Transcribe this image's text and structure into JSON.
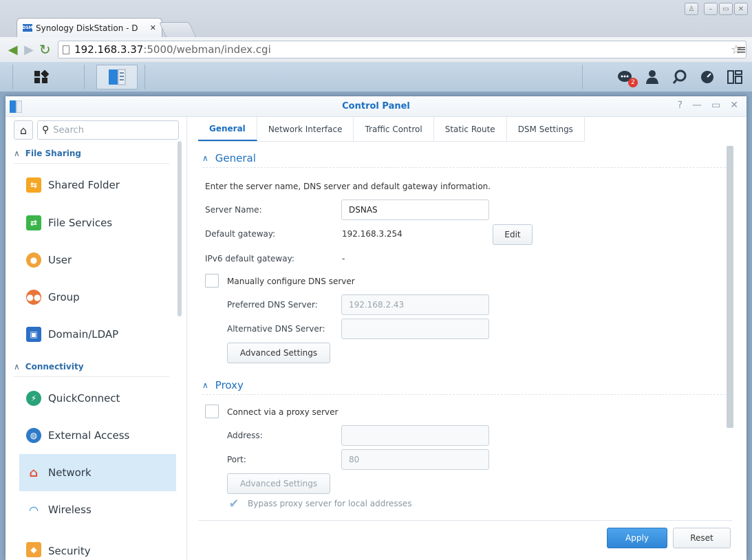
{
  "browser": {
    "tab_title": "Synology DiskStation - D",
    "favicon_text": "DSM",
    "url_host": "192.168.3.37",
    "url_rest": ":5000/webman/index.cgi"
  },
  "taskbar": {
    "notification_count": "2"
  },
  "window": {
    "title": "Control Panel"
  },
  "sidebar": {
    "search_placeholder": "Search",
    "sections": [
      {
        "label": "File Sharing"
      },
      {
        "label": "Connectivity"
      }
    ],
    "items": [
      {
        "label": "Shared Folder",
        "icon": "shared-folder-icon",
        "color": "#f5a623"
      },
      {
        "label": "File Services",
        "icon": "file-services-icon",
        "color": "#3bb54a"
      },
      {
        "label": "User",
        "icon": "user-icon",
        "color": "#f0a33a"
      },
      {
        "label": "Group",
        "icon": "group-icon",
        "color": "#e9753b"
      },
      {
        "label": "Domain/LDAP",
        "icon": "domain-ldap-icon",
        "color": "#2b6fc6"
      },
      {
        "label": "QuickConnect",
        "icon": "quickconnect-icon",
        "color": "#2aa27b"
      },
      {
        "label": "External Access",
        "icon": "globe-icon",
        "color": "#2e7ac7"
      },
      {
        "label": "Network",
        "icon": "network-house-icon",
        "color": "#e2543b",
        "active": true
      },
      {
        "label": "Wireless",
        "icon": "wifi-icon",
        "color": "#1a8fd6"
      },
      {
        "label": "Security",
        "icon": "shield-icon",
        "color": "#f2a33a"
      }
    ]
  },
  "tabs": [
    "General",
    "Network Interface",
    "Traffic Control",
    "Static Route",
    "DSM Settings"
  ],
  "general": {
    "heading": "General",
    "description": "Enter the server name, DNS server and default gateway information.",
    "server_name_label": "Server Name:",
    "server_name_value": "DSNAS",
    "gateway_label": "Default gateway:",
    "gateway_value": "192.168.3.254",
    "edit_label": "Edit",
    "ipv6_label": "IPv6 default gateway:",
    "ipv6_value": "-",
    "manual_dns_label": "Manually configure DNS server",
    "preferred_dns_label": "Preferred DNS Server:",
    "preferred_dns_value": "192.168.2.43",
    "alternative_dns_label": "Alternative DNS Server:",
    "alternative_dns_value": "",
    "advanced_label": "Advanced Settings"
  },
  "proxy": {
    "heading": "Proxy",
    "connect_label": "Connect via a proxy server",
    "address_label": "Address:",
    "address_value": "",
    "port_label": "Port:",
    "port_value": "80",
    "advanced_label": "Advanced Settings",
    "bypass_label": "Bypass proxy server for local addresses"
  },
  "footer": {
    "apply_label": "Apply",
    "reset_label": "Reset"
  },
  "colors": {
    "accent": "#1c6fc0",
    "apply": "#3a93de",
    "active_row": "#d6eaf8"
  }
}
